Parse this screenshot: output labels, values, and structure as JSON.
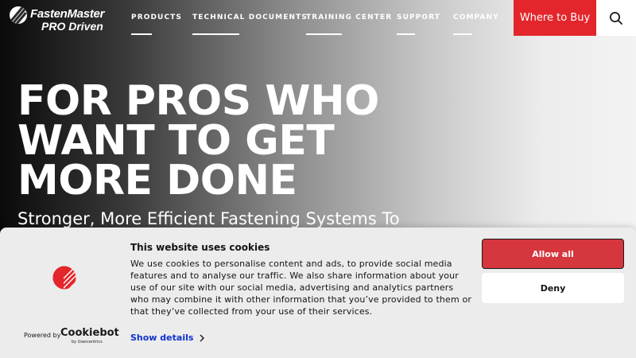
{
  "header": {
    "logo_top": "FastenMaster",
    "logo_bottom": "PRO Driven",
    "nav": [
      {
        "label": "PRODUCTS"
      },
      {
        "label": "TECHNICAL DOCUMENTS"
      },
      {
        "label": "TRAINING CENTER"
      },
      {
        "label": "SUPPORT"
      },
      {
        "label": "COMPANY"
      }
    ],
    "where_to_buy": "Where to Buy",
    "search_icon": "search-icon"
  },
  "hero": {
    "headline_lines": [
      "FOR PROS WHO",
      "WANT TO GET",
      "MORE DONE"
    ],
    "subheadline": "Stronger, More Efficient Fastening Systems To"
  },
  "cookie_banner": {
    "title": "This website uses cookies",
    "body": "We use cookies to personalise content and ads, to provide social media features and to analyse our traffic. We also share information about your use of our site with our social media, advertising and analytics partners who may combine it with other information that you’ve provided to them or that they’ve collected from your use of their services.",
    "show_details": "Show details",
    "powered_by": "Powered by",
    "cookiebot": "Cookiebot",
    "cookiebot_sub": "by Usercentrics",
    "allow_all": "Allow all",
    "deny": "Deny"
  },
  "colors": {
    "accent_red": "#e3262b",
    "allow_red": "#d6363e",
    "link_blue": "#1032cf"
  }
}
